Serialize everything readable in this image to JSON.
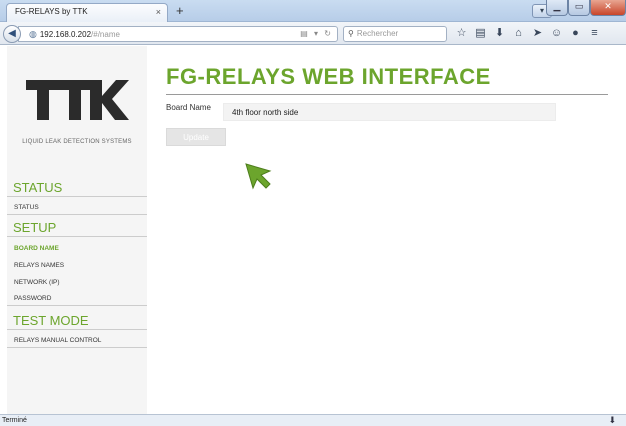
{
  "browser": {
    "tab_title": "FG-RELAYS by TTK",
    "tab_close": "×",
    "new_tab": "+",
    "url_host": "192.168.0.202",
    "url_path": "/#/name",
    "search_placeholder": "Rechercher",
    "toolbar_icons": [
      "star-icon",
      "bookmarks-icon",
      "download-icon",
      "home-icon",
      "send-icon",
      "emoji-icon",
      "chat-icon",
      "menu-icon"
    ],
    "status_text": "Terminé"
  },
  "sidebar": {
    "tagline": "LIQUID LEAK DETECTION SYSTEMS",
    "sections": {
      "status": "STATUS",
      "setup": "SETUP",
      "test": "TEST MODE"
    },
    "items": {
      "status": "STATUS",
      "board_name": "BOARD NAME",
      "relays_names": "RELAYS NAMES",
      "network": "NETWORK (IP)",
      "password": "PASSWORD",
      "relays_manual": "RELAYS MANUAL CONTROL"
    }
  },
  "main": {
    "title": "FG-RELAYS WEB INTERFACE",
    "field_label": "Board Name",
    "field_value": "4th floor north side",
    "update_label": "Update"
  },
  "colors": {
    "accent": "#6ca52d",
    "logo": "#2b2b2b"
  }
}
